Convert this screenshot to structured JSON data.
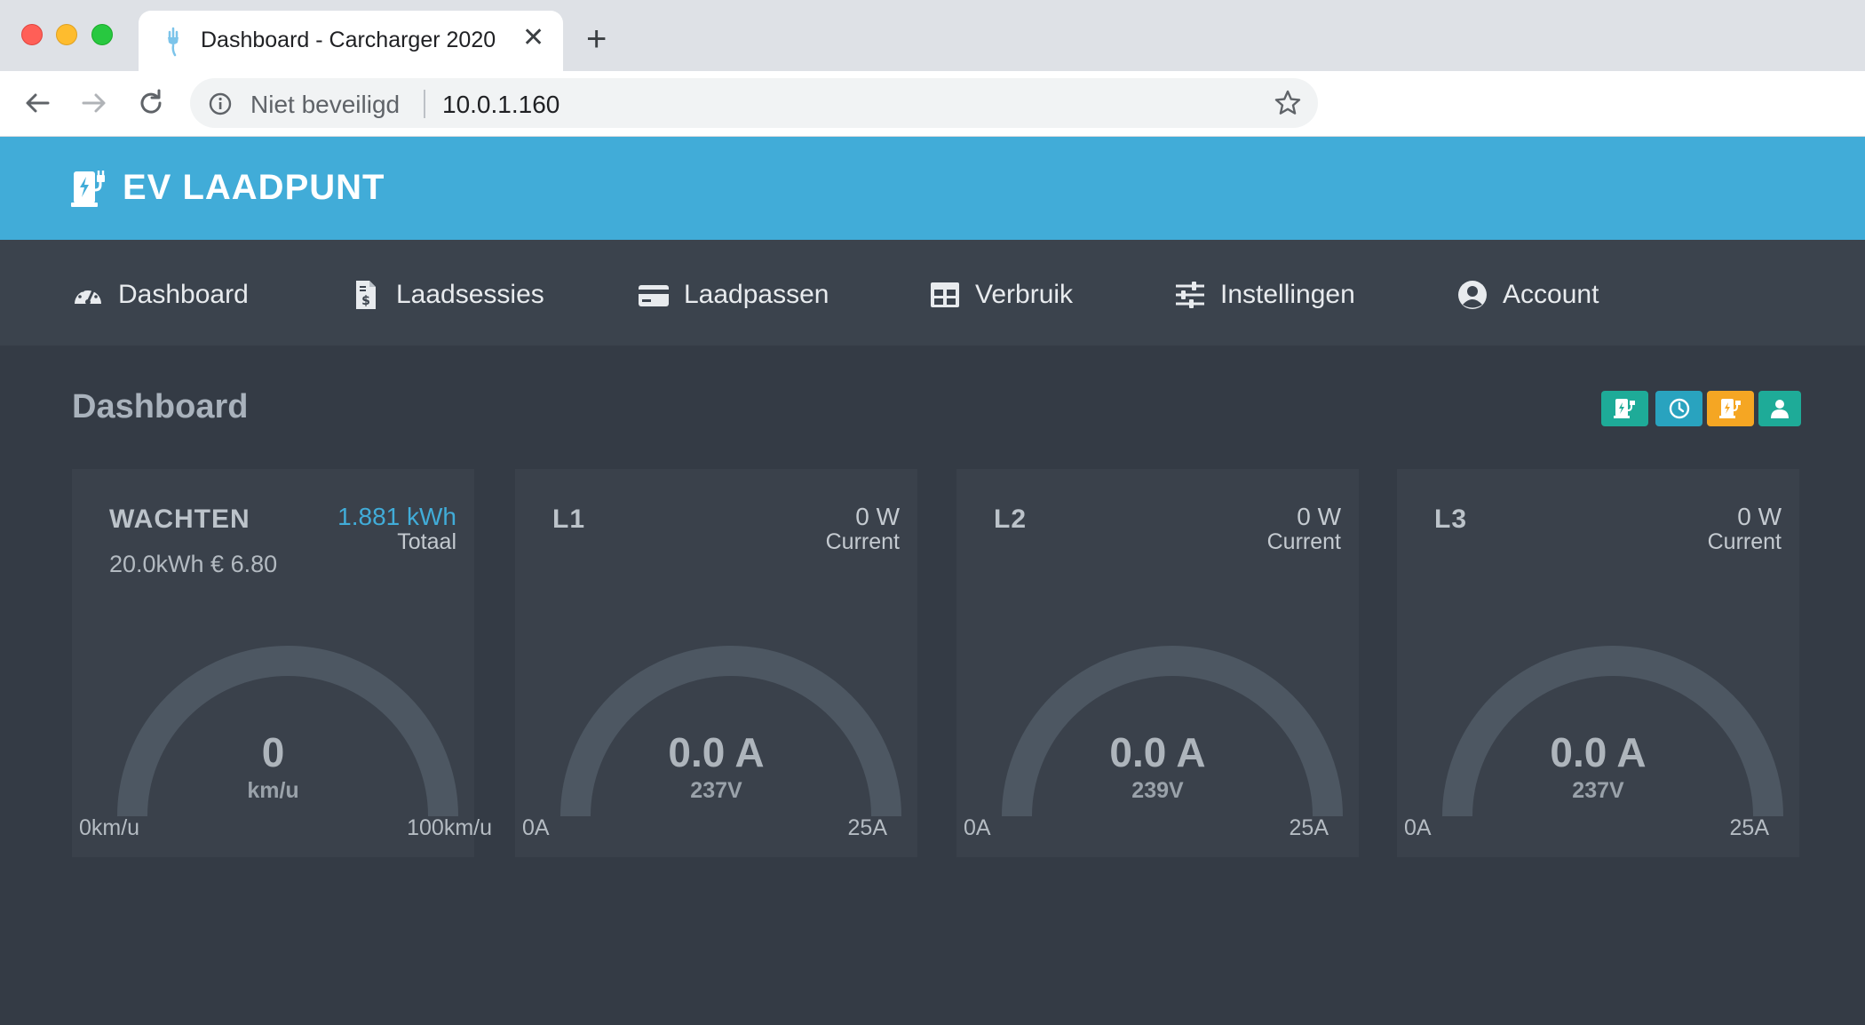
{
  "browser": {
    "tab_title": "Dashboard - Carcharger 2020",
    "security_label": "Niet beveiligd",
    "url": "10.0.1.160"
  },
  "app": {
    "brand": "EV LAADPUNT",
    "nav": [
      {
        "label": "Dashboard",
        "icon": "gauge-icon"
      },
      {
        "label": "Laadsessies",
        "icon": "invoice-icon"
      },
      {
        "label": "Laadpassen",
        "icon": "credit-card-icon"
      },
      {
        "label": "Verbruik",
        "icon": "table-icon"
      },
      {
        "label": "Instellingen",
        "icon": "sliders-icon"
      },
      {
        "label": "Account",
        "icon": "user-circle-icon"
      }
    ],
    "page_title": "Dashboard",
    "quick_buttons": [
      {
        "icon": "charger-icon",
        "color": "#1eab98"
      },
      {
        "icon": "clock-icon",
        "color": "#29a3bf"
      },
      {
        "icon": "charger-icon",
        "color": "#f5a623"
      },
      {
        "icon": "user-icon",
        "color": "#1eab98"
      }
    ],
    "cards": [
      {
        "title": "WACHTEN",
        "value": "1.881 kWh",
        "sub": "Totaal",
        "extra": "20.0kWh € 6.80",
        "gauge_value": "0",
        "gauge_unit": "km/u",
        "gauge_min": "0km/u",
        "gauge_max": "100km/u",
        "gauge_fraction": 0
      },
      {
        "title": "L1",
        "value": "0 W",
        "sub": "Current",
        "gauge_value": "0.0 A",
        "gauge_unit": "237V",
        "gauge_min": "0A",
        "gauge_max": "25A",
        "gauge_fraction": 0
      },
      {
        "title": "L2",
        "value": "0 W",
        "sub": "Current",
        "gauge_value": "0.0 A",
        "gauge_unit": "239V",
        "gauge_min": "0A",
        "gauge_max": "25A",
        "gauge_fraction": 0
      },
      {
        "title": "L3",
        "value": "0 W",
        "sub": "Current",
        "gauge_value": "0.0 A",
        "gauge_unit": "237V",
        "gauge_min": "0A",
        "gauge_max": "25A",
        "gauge_fraction": 0
      }
    ]
  }
}
